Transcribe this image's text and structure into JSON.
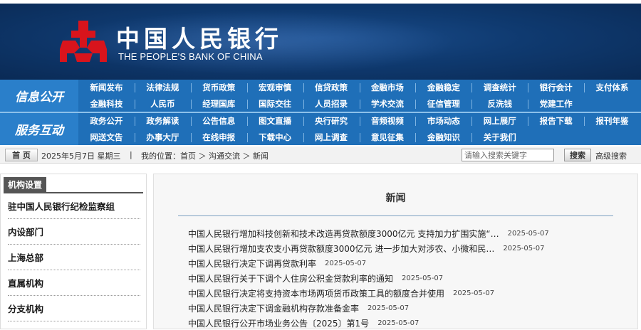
{
  "header": {
    "title_cn": "中国人民银行",
    "title_en": "THE PEOPLE'S BANK OF CHINA"
  },
  "nav": {
    "block1_label": "信息公开",
    "block2_label": "服务互动",
    "rows": [
      [
        "新闻发布",
        "法律法规",
        "货币政策",
        "宏观审慎",
        "信贷政策",
        "金融市场",
        "金融稳定",
        "调查统计",
        "银行会计",
        "支付体系"
      ],
      [
        "金融科技",
        "人民币",
        "经理国库",
        "国际交往",
        "人员招录",
        "学术交流",
        "征信管理",
        "反洗钱",
        "党建工作"
      ],
      [
        "政务公开",
        "政务解读",
        "公告信息",
        "图文直播",
        "央行研究",
        "音频视频",
        "市场动态",
        "网上展厅",
        "报告下载",
        "报刊年鉴"
      ],
      [
        "网送文告",
        "办事大厅",
        "在线申报",
        "下载中心",
        "网上调查",
        "意见征集",
        "金融知识",
        "关于我们"
      ]
    ]
  },
  "breadcrumb": {
    "home_label": "首 页",
    "date": "2025年5月7日 星期三",
    "separator": "|",
    "location": "我的位置：首页 ＞ 沟通交流 ＞ 新闻",
    "search_placeholder": "请输入搜索关键字",
    "search_button": "搜索",
    "advanced_search": "高级搜索"
  },
  "sidebar": {
    "title": "机构设置",
    "items": [
      "驻中国人民银行纪检监察组",
      "内设部门",
      "上海总部",
      "直属机构",
      "分支机构"
    ]
  },
  "main": {
    "title": "新闻",
    "news": [
      {
        "title": "中国人民银行增加科技创新和技术改造再贷款额度3000亿元 支持加力扩围实施“…",
        "date": "2025-05-07"
      },
      {
        "title": "中国人民银行增加支农支小再贷款额度3000亿元 进一步加大对涉农、小微和民…",
        "date": "2025-05-07"
      },
      {
        "title": "中国人民银行决定下调再贷款利率",
        "date": "2025-05-07"
      },
      {
        "title": "中国人民银行关于下调个人住房公积金贷款利率的通知",
        "date": "2025-05-07"
      },
      {
        "title": "中国人民银行决定将支持资本市场两项货币政策工具的额度合并使用",
        "date": "2025-05-07"
      },
      {
        "title": "中国人民银行决定下调金融机构存款准备金率",
        "date": "2025-05-07"
      },
      {
        "title": "中国人民银行公开市场业务公告〔2025〕第1号",
        "date": "2025-05-07"
      }
    ]
  },
  "colors": {
    "header_bg": "#0f3a70",
    "nav_bg": "#1f6fb8",
    "emblem_red": "#d8141c"
  }
}
